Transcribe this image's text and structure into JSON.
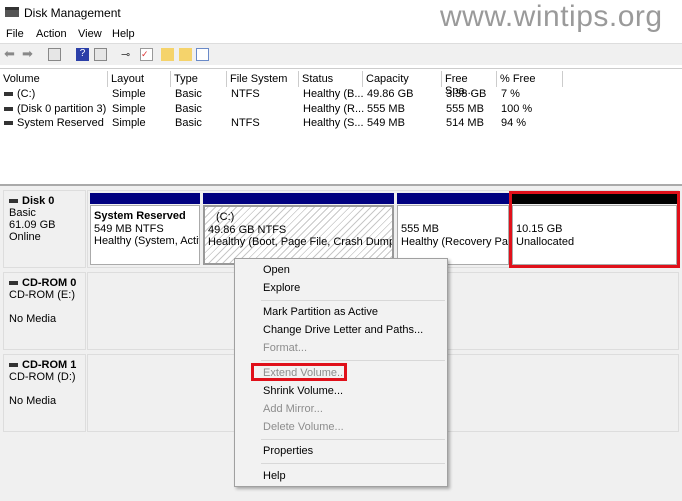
{
  "window": {
    "title": "Disk Management",
    "watermark": "www.wintips.org"
  },
  "menu": [
    "File",
    "Action",
    "View",
    "Help"
  ],
  "toolbar": [
    "back-icon",
    "forward-icon",
    "console-tree-icon",
    "help-icon",
    "action-pane-icon",
    "connect-icon",
    "check-icon",
    "folder-up-icon",
    "folder-search-icon",
    "properties-icon"
  ],
  "columns": [
    "Volume",
    "Layout",
    "Type",
    "File System",
    "Status",
    "Capacity",
    "Free Spa...",
    "% Free"
  ],
  "volumes": [
    [
      "(C:)",
      "Simple",
      "Basic",
      "NTFS",
      "Healthy (B...",
      "49.86 GB",
      "3.38 GB",
      "7 %"
    ],
    [
      "(Disk 0 partition 3)",
      "Simple",
      "Basic",
      "",
      "Healthy (R...",
      "555 MB",
      "555 MB",
      "100 %"
    ],
    [
      "System Reserved",
      "Simple",
      "Basic",
      "NTFS",
      "Healthy (S...",
      "549 MB",
      "514 MB",
      "94 %"
    ]
  ],
  "disks": [
    {
      "name": "Disk 0",
      "type": "Basic",
      "size": "61.09 GB",
      "state": "Online"
    },
    {
      "name": "CD-ROM 0",
      "type": "CD-ROM (E:)",
      "state": "No Media"
    },
    {
      "name": "CD-ROM 1",
      "type": "CD-ROM (D:)",
      "state": "No Media"
    }
  ],
  "partitions": [
    {
      "name": "System Reserved",
      "size": "549 MB NTFS",
      "status": "Healthy (System, Active"
    },
    {
      "name": "(C:)",
      "size": "49.86 GB NTFS",
      "status": "Healthy (Boot, Page File, Crash Dump, Pri"
    },
    {
      "size": "555 MB",
      "status": "Healthy (Recovery Part"
    },
    {
      "size": "10.15 GB",
      "status": "Unallocated"
    }
  ],
  "context_menu": [
    "Open",
    "Explore",
    "Mark Partition as Active",
    "Change Drive Letter and Paths...",
    "Format...",
    "Extend Volume...",
    "Shrink Volume...",
    "Add Mirror...",
    "Delete Volume...",
    "Properties",
    "Help"
  ],
  "colors": {
    "primary_bar": "#000080",
    "unallocated_bar": "#000000",
    "highlight": "#e0101a"
  }
}
